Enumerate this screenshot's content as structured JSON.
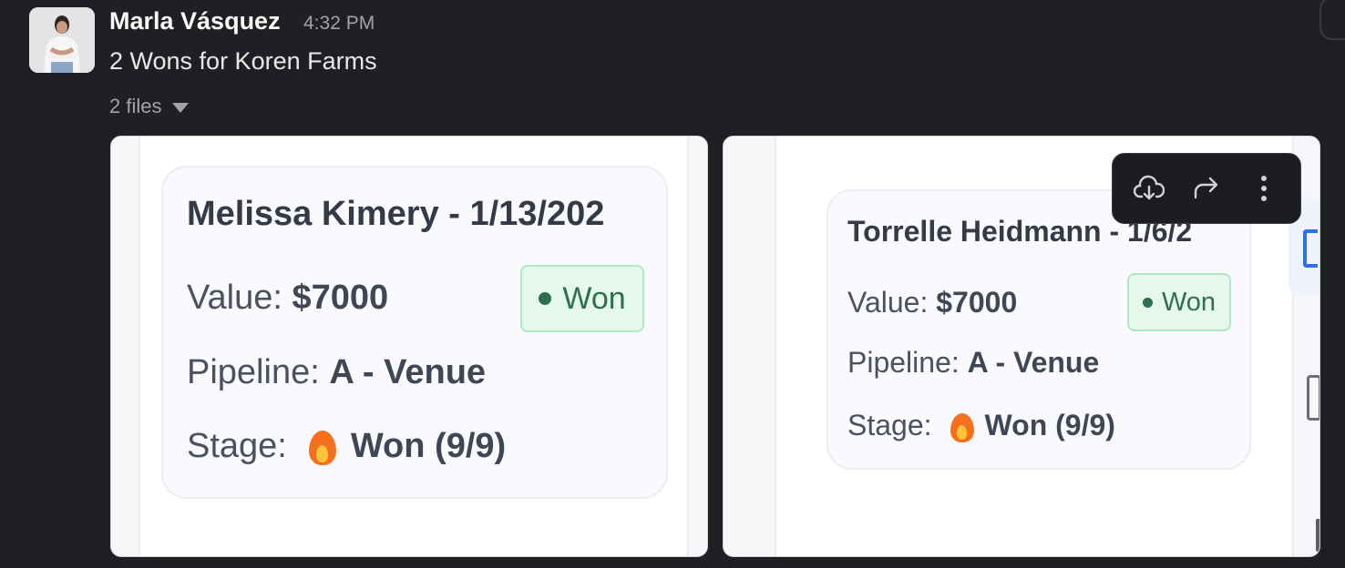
{
  "message": {
    "author": "Marla Vásquez",
    "time": "4:32 PM",
    "text": "2 Wons for Koren Farms",
    "files_label": "2 files"
  },
  "attachments": [
    {
      "title": "Melissa Kimery - 1/13/202",
      "value_label": "Value:",
      "value": "$7000",
      "status": "Won",
      "pipeline_label": "Pipeline:",
      "pipeline": "A - Venue",
      "stage_label": "Stage:",
      "stage": "Won (9/9)"
    },
    {
      "title": "Torrelle Heidmann - 1/6/2",
      "value_label": "Value:",
      "value": "$7000",
      "status": "Won",
      "pipeline_label": "Pipeline:",
      "pipeline": "A - Venue",
      "stage_label": "Stage:",
      "stage": "Won (9/9)"
    }
  ],
  "toolbar": {
    "icons": [
      "download-icon",
      "share-icon",
      "more-vertical-icon"
    ]
  },
  "colors": {
    "background": "#1f2024",
    "won_badge_bg": "#e6f8ec",
    "won_badge_text": "#2f6f4e",
    "card_text": "#363c4b"
  }
}
